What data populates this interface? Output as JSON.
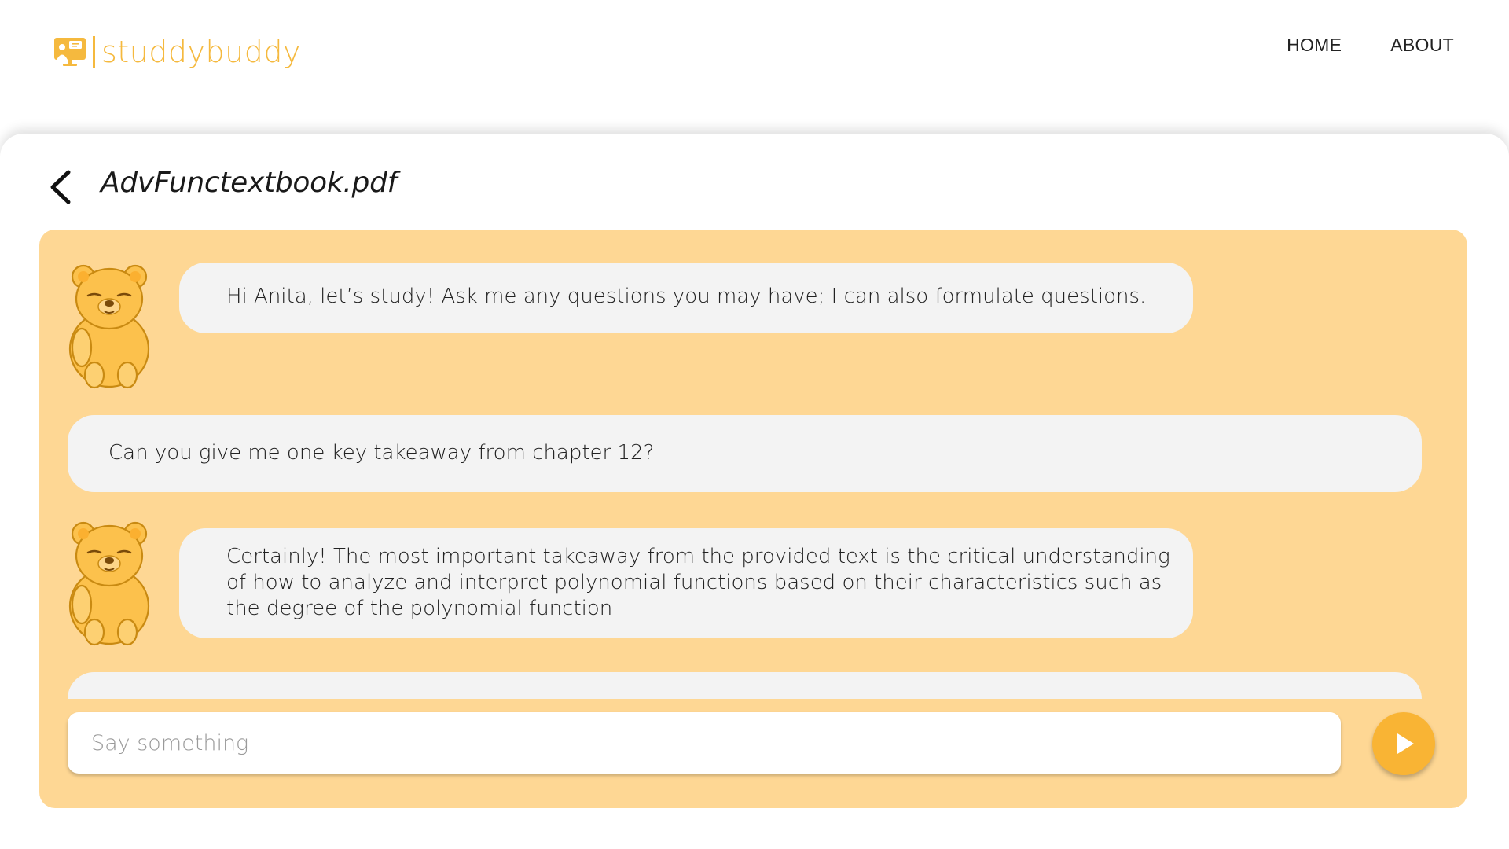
{
  "header": {
    "logo_text": "studdybuddy",
    "nav": [
      {
        "label": "HOME"
      },
      {
        "label": "ABOUT"
      }
    ]
  },
  "chat": {
    "document_title": "AdvFunctextbook.pdf",
    "messages": [
      {
        "sender": "bot",
        "text": "Hi Anita, let’s study! Ask me any questions you may have; I can also formulate questions."
      },
      {
        "sender": "user",
        "text": "Can you give me one key takeaway from chapter 12?"
      },
      {
        "sender": "bot",
        "lines": [
          "Certainly! The most important takeaway from the provided text is the critical understanding",
          "of how to analyze and interpret polynomial functions based on their characteristics such as",
          "the degree of the polynomial function"
        ]
      },
      {
        "sender": "user",
        "text": ""
      }
    ],
    "input": {
      "placeholder": "Say something",
      "value": ""
    }
  },
  "colors": {
    "brand": "#f5b93e",
    "panel_bg": "#fed794",
    "bubble_bg": "#f3f3f3",
    "send_button": "#f9b434"
  },
  "icons": {
    "logo": "presentation-board-icon",
    "back": "chevron-left-icon",
    "avatar": "bear-avatar-icon",
    "send": "play-triangle-icon"
  }
}
